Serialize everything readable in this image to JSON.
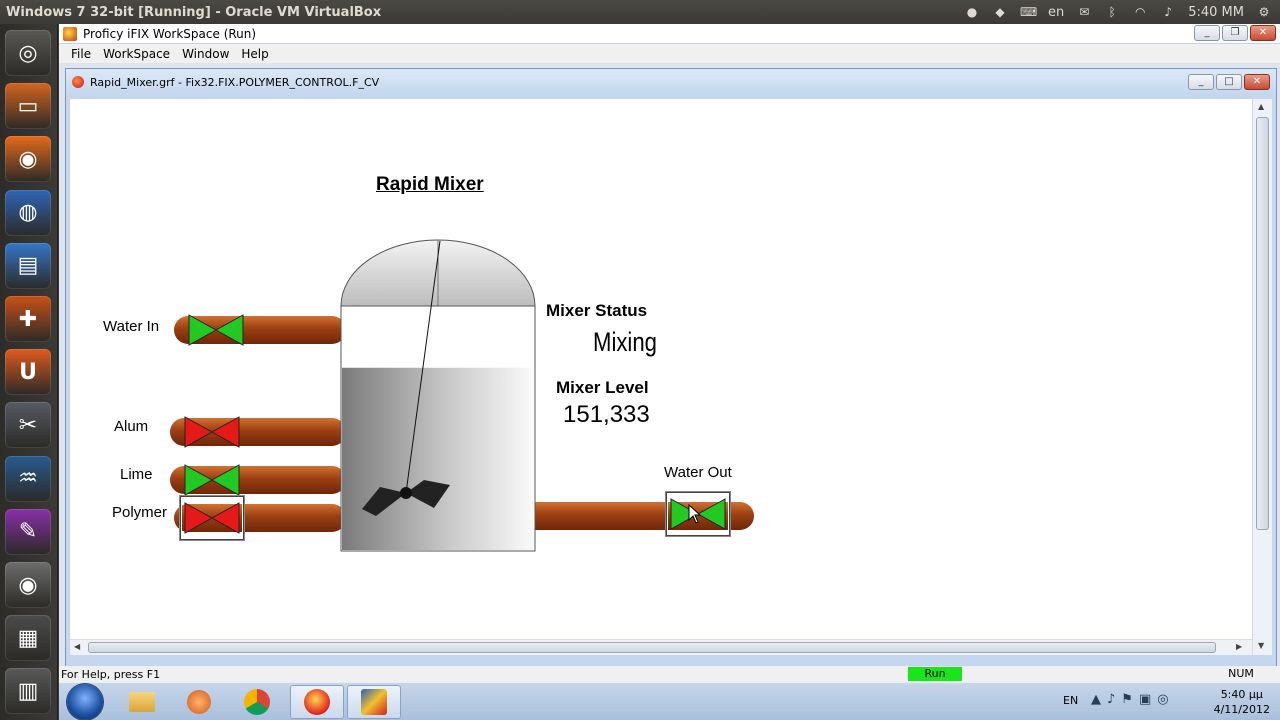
{
  "host": {
    "title": "Windows 7 32-bit [Running] - Oracle VM VirtualBox",
    "language": "en",
    "clock": "5:40 MM"
  },
  "launcher": {
    "items": [
      {
        "name": "ubuntu-home-icon",
        "color": "#5a5954"
      },
      {
        "name": "files-icon",
        "color": "#d4651f"
      },
      {
        "name": "firefox-icon",
        "color": "#e66a1a"
      },
      {
        "name": "chromium-icon",
        "color": "#2f66b8"
      },
      {
        "name": "document-viewer-icon",
        "color": "#3477c9"
      },
      {
        "name": "software-center-icon",
        "color": "#c95018"
      },
      {
        "name": "ubuntu-one-icon",
        "color": "#e05a1c"
      },
      {
        "name": "system-settings-icon",
        "color": "#565b63"
      },
      {
        "name": "system-monitor-icon",
        "color": "#275b8e"
      },
      {
        "name": "video-editor-icon",
        "color": "#8a2fa8"
      },
      {
        "name": "disc-icon",
        "color": "#6d6d6d"
      },
      {
        "name": "workspace-switcher-icon",
        "color": "#4c4c4c"
      },
      {
        "name": "trash-icon",
        "color": "#595959"
      }
    ]
  },
  "app": {
    "title": "Proficy iFIX WorkSpace (Run)",
    "menu": [
      "File",
      "WorkSpace",
      "Window",
      "Help"
    ]
  },
  "child": {
    "title": "Rapid_Mixer.grf - Fix32.FIX.POLYMER_CONTROL.F_CV"
  },
  "hmi": {
    "heading": "Rapid Mixer",
    "status_label": "Mixer Status",
    "status_value": "Mixing",
    "level_label": "Mixer Level",
    "level_value": "151,333",
    "inlets": [
      {
        "label": "Water In",
        "valve_state": "open",
        "color": "#22c922"
      },
      {
        "label": "Alum",
        "valve_state": "closed",
        "color": "#e61919"
      },
      {
        "label": "Lime",
        "valve_state": "open",
        "color": "#22c922"
      },
      {
        "label": "Polymer",
        "valve_state": "closed",
        "color": "#e61919"
      }
    ],
    "outlet": {
      "label": "Water Out",
      "valve_state": "open",
      "color": "#22c922"
    },
    "tank_fill_fraction": 0.75
  },
  "statusbar": {
    "help": "For Help, press F1",
    "mode": "Run",
    "num": "NUM"
  },
  "taskbar": {
    "lang": "EN",
    "time": "5:40 μμ",
    "date": "4/11/2012"
  }
}
